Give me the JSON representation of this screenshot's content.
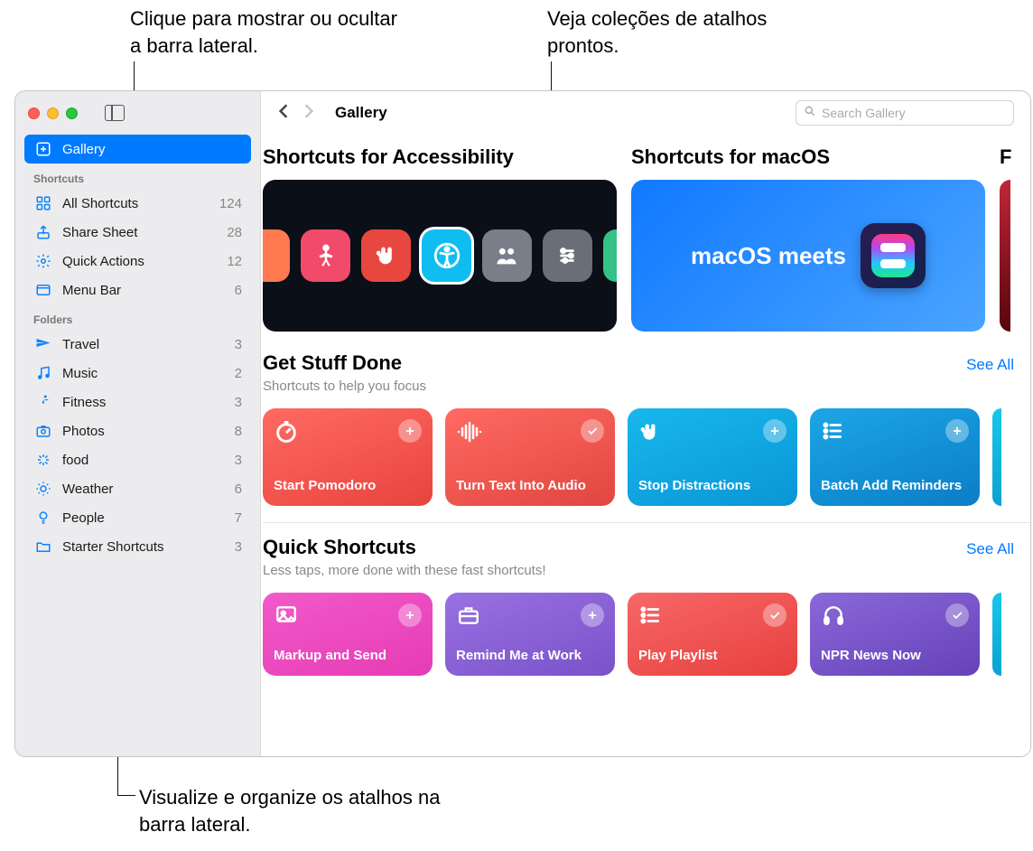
{
  "callouts": {
    "top_left": "Clique para mostrar ou ocultar a barra lateral.",
    "top_right": "Veja coleções de atalhos prontos.",
    "bottom": "Visualize e organize os atalhos na barra lateral."
  },
  "toolbar": {
    "title": "Gallery",
    "search_placeholder": "Search Gallery"
  },
  "sidebar": {
    "gallery_label": "Gallery",
    "shortcuts_header": "Shortcuts",
    "shortcuts": [
      {
        "label": "All Shortcuts",
        "count": "124",
        "icon": "grid"
      },
      {
        "label": "Share Sheet",
        "count": "28",
        "icon": "share"
      },
      {
        "label": "Quick Actions",
        "count": "12",
        "icon": "gear"
      },
      {
        "label": "Menu Bar",
        "count": "6",
        "icon": "menubar"
      }
    ],
    "folders_header": "Folders",
    "folders": [
      {
        "label": "Travel",
        "count": "3",
        "icon": "plane"
      },
      {
        "label": "Music",
        "count": "2",
        "icon": "music"
      },
      {
        "label": "Fitness",
        "count": "3",
        "icon": "run"
      },
      {
        "label": "Photos",
        "count": "8",
        "icon": "camera"
      },
      {
        "label": "food",
        "count": "3",
        "icon": "rays"
      },
      {
        "label": "Weather",
        "count": "6",
        "icon": "sun"
      },
      {
        "label": "People",
        "count": "7",
        "icon": "bulb"
      },
      {
        "label": "Starter Shortcuts",
        "count": "3",
        "icon": "folder"
      }
    ]
  },
  "banners": [
    {
      "title": "Shortcuts for Accessibility",
      "style": "access"
    },
    {
      "title": "Shortcuts for macOS",
      "style": "macos",
      "text": "macOS meets"
    },
    {
      "title": "F",
      "style": "partial"
    }
  ],
  "sections": [
    {
      "title": "Get Stuff Done",
      "subtitle": "Shortcuts to help you focus",
      "see_all": "See All",
      "cards": [
        {
          "name": "Start Pomodoro",
          "color": "red1",
          "glyph": "timer",
          "action": "plus"
        },
        {
          "name": "Turn Text Into Audio",
          "color": "red2",
          "glyph": "wave",
          "action": "check"
        },
        {
          "name": "Stop Distractions",
          "color": "blue",
          "glyph": "hand",
          "action": "plus"
        },
        {
          "name": "Batch Add Reminders",
          "color": "bluedk",
          "glyph": "list",
          "action": "plus"
        }
      ]
    },
    {
      "title": "Quick Shortcuts",
      "subtitle": "Less taps, more done with these fast shortcuts!",
      "see_all": "See All",
      "cards": [
        {
          "name": "Markup and Send",
          "color": "pink",
          "glyph": "image",
          "action": "plus"
        },
        {
          "name": "Remind Me at Work",
          "color": "purple",
          "glyph": "briefcase",
          "action": "plus"
        },
        {
          "name": "Play Playlist",
          "color": "redp",
          "glyph": "list",
          "action": "check"
        },
        {
          "name": "NPR News Now",
          "color": "violet",
          "glyph": "headphones",
          "action": "check"
        }
      ]
    }
  ]
}
